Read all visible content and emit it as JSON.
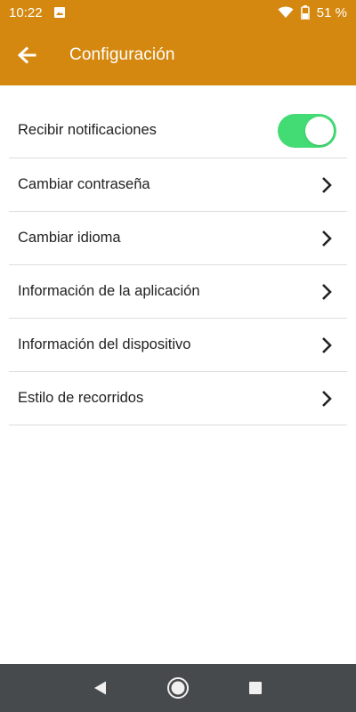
{
  "status_bar": {
    "time": "10:22",
    "battery_percent": "51 %",
    "icons": [
      "image-icon",
      "wifi-icon",
      "battery-icon"
    ]
  },
  "app_bar": {
    "title": "Configuración",
    "back_icon": "arrow-left-icon",
    "background": "#d4880f"
  },
  "settings": {
    "items": [
      {
        "label": "Recibir notificaciones",
        "control": "toggle",
        "toggle_on": true
      },
      {
        "label": "Cambiar contraseña",
        "control": "chevron"
      },
      {
        "label": "Cambiar idioma",
        "control": "chevron"
      },
      {
        "label": "Información de la aplicación",
        "control": "chevron"
      },
      {
        "label": "Información del dispositivo",
        "control": "chevron"
      },
      {
        "label": "Estilo de recorridos",
        "control": "chevron"
      }
    ],
    "toggle_color": "#43db73"
  },
  "nav_bar": {
    "buttons": [
      "back-triangle-icon",
      "home-circle-icon",
      "recents-square-icon"
    ],
    "background": "#474a4d"
  }
}
